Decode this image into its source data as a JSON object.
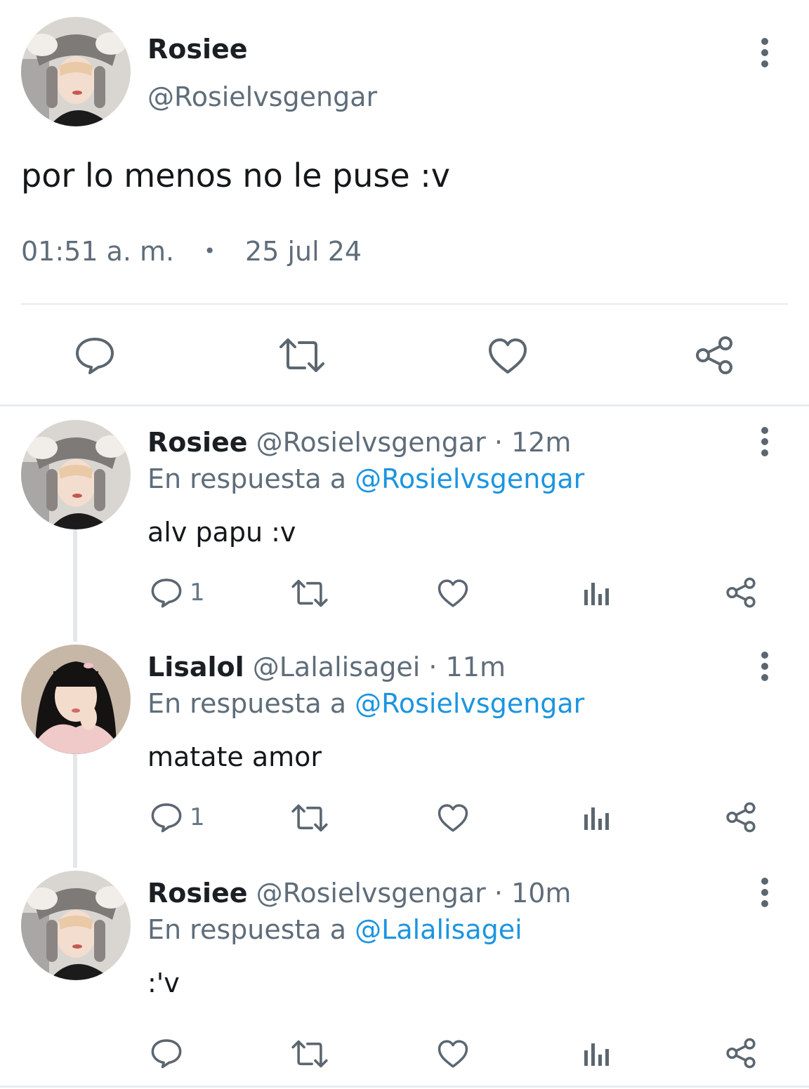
{
  "main_tweet": {
    "name": "Rosiee",
    "handle": "@Rosielvsgengar",
    "text": "por lo menos no le puse :v",
    "time": "01:51 a. m.",
    "separator": "•",
    "date": "25 jul 24",
    "avatar": "rosiee-avatar"
  },
  "replies": [
    {
      "name": "Rosiee",
      "handle": "@Rosielvsgengar",
      "dot": "·",
      "age": "12m",
      "reply_prefix": "En respuesta a",
      "reply_to": "@Rosielvsgengar",
      "text": "alv papu :v",
      "reply_count": "1",
      "avatar": "rosiee-avatar"
    },
    {
      "name": "Lisalol",
      "handle": "@Lalalisagei",
      "dot": "·",
      "age": "11m",
      "reply_prefix": "En respuesta a",
      "reply_to": "@Rosielvsgengar",
      "text": "matate amor",
      "reply_count": "1",
      "avatar": "lisalol-avatar"
    },
    {
      "name": "Rosiee",
      "handle": "@Rosielvsgengar",
      "dot": "·",
      "age": "10m",
      "reply_prefix": "En respuesta a",
      "reply_to": "@Lalalisagei",
      "text": ":'v",
      "reply_count": "",
      "avatar": "rosiee-avatar"
    }
  ],
  "icons": [
    "reply-icon",
    "retweet-icon",
    "like-icon",
    "analytics-icon",
    "share-icon",
    "more-icon"
  ],
  "colors": {
    "link": "#1b95e0",
    "secondary": "#657786",
    "divider": "#e6ecf0",
    "icon": "#5b6670"
  }
}
